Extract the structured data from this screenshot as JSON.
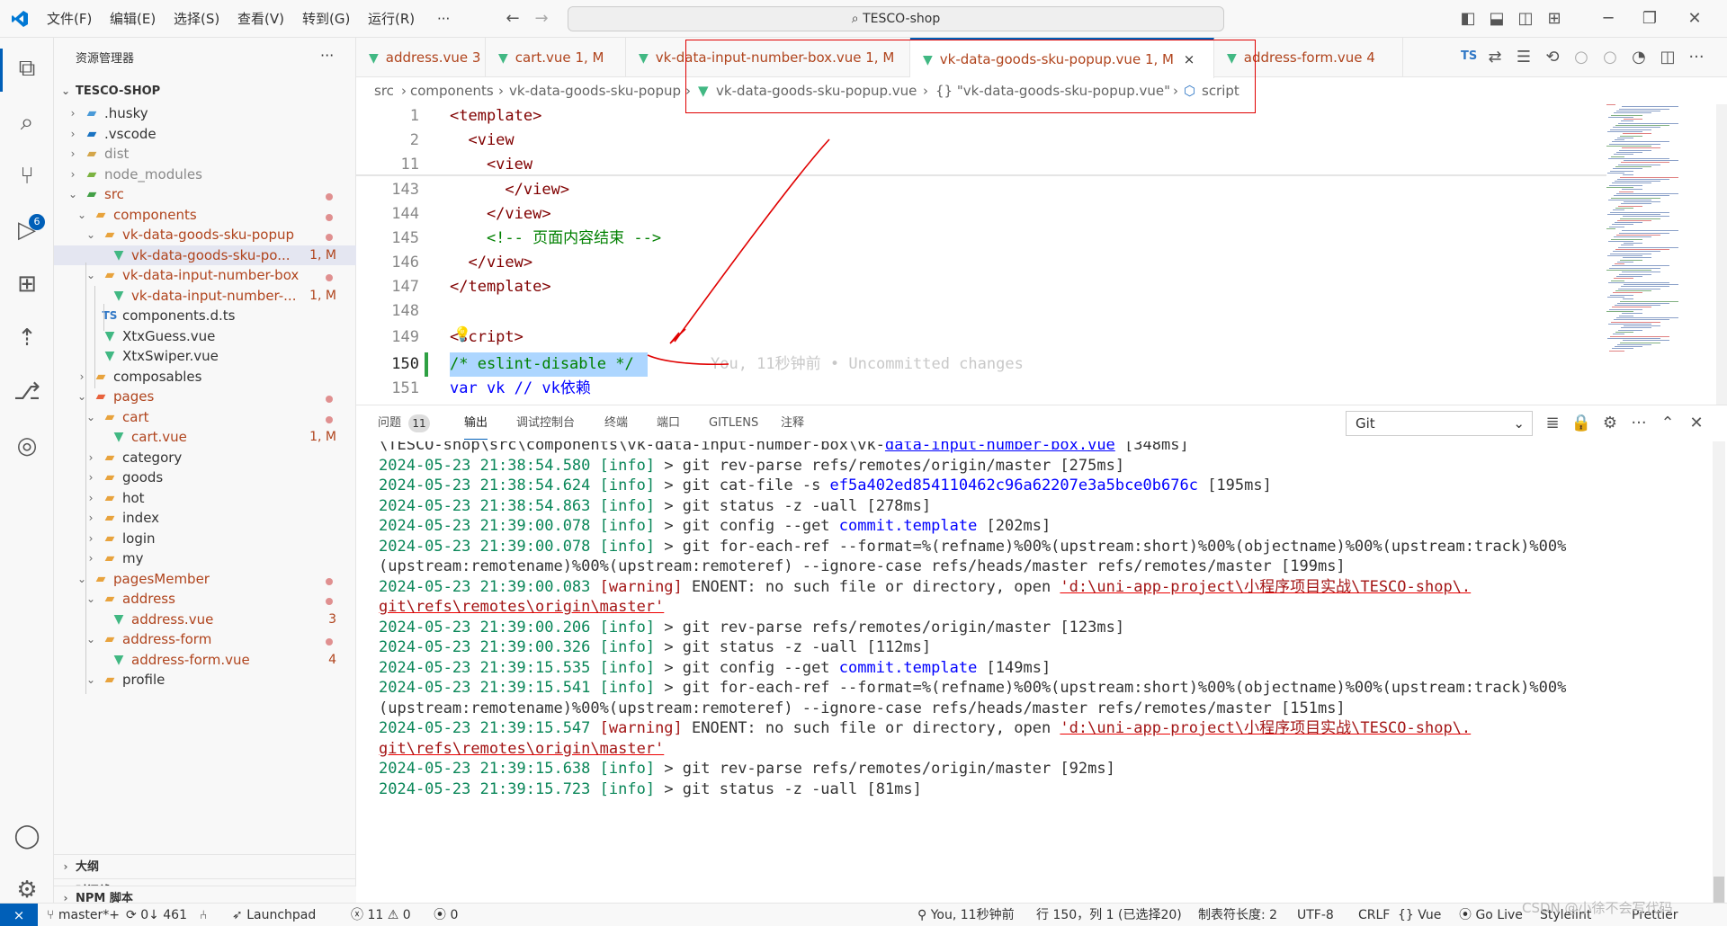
{
  "menu": [
    "文件(F)",
    "编辑(E)",
    "选择(S)",
    "查看(V)",
    "转到(G)",
    "运行(R)",
    "···"
  ],
  "search": {
    "text": "TESCO-shop"
  },
  "activity_badge": "6",
  "sidebar": {
    "title": "资源管理器",
    "more": "···",
    "root": "TESCO-SHOP",
    "items": [
      {
        "label": ".husky"
      },
      {
        "label": ".vscode"
      },
      {
        "label": "dist"
      },
      {
        "label": "node_modules"
      },
      {
        "label": "src"
      },
      {
        "label": "components"
      },
      {
        "label": "vk-data-goods-sku-popup"
      },
      {
        "label": "vk-data-goods-sku-po...",
        "badge": "1, M"
      },
      {
        "label": "vk-data-input-number-box"
      },
      {
        "label": "vk-data-input-number-...",
        "badge": "1, M"
      },
      {
        "label": "components.d.ts",
        "icon": "TS"
      },
      {
        "label": "XtxGuess.vue"
      },
      {
        "label": "XtxSwiper.vue"
      },
      {
        "label": "composables"
      },
      {
        "label": "pages"
      },
      {
        "label": "cart"
      },
      {
        "label": "cart.vue",
        "badge": "1, M"
      },
      {
        "label": "category"
      },
      {
        "label": "goods"
      },
      {
        "label": "hot"
      },
      {
        "label": "index"
      },
      {
        "label": "login"
      },
      {
        "label": "my"
      },
      {
        "label": "pagesMember"
      },
      {
        "label": "address"
      },
      {
        "label": "address.vue",
        "badge": "3"
      },
      {
        "label": "address-form"
      },
      {
        "label": "address-form.vue",
        "badge": "4"
      },
      {
        "label": "profile"
      }
    ],
    "sections": [
      "大纲",
      "时间线",
      "NPM 脚本"
    ]
  },
  "tabs": [
    {
      "label": "address.vue",
      "badge": "3"
    },
    {
      "label": "cart.vue",
      "badge": "1, M"
    },
    {
      "label": "vk-data-input-number-box.vue",
      "badge": "1, M"
    },
    {
      "label": "vk-data-goods-sku-popup.vue",
      "badge": "1, M",
      "close": "×"
    },
    {
      "label": "address-form.vue",
      "badge": "4"
    }
  ],
  "ts_label": "TS",
  "breadcrumb": {
    "p1": "src",
    "p2": "components",
    "p3": "vk-data-goods-sku-popup",
    "p4": "vk-data-goods-sku-popup.vue",
    "p5": "{} \"vk-data-goods-sku-popup.vue\"",
    "p6": "script"
  },
  "code": [
    {
      "n": "1",
      "t": "<template>"
    },
    {
      "n": "2",
      "t": "  <view"
    },
    {
      "n": "11",
      "t": "    <view"
    },
    {
      "n": "143",
      "t": "      </view>"
    },
    {
      "n": "144",
      "t": "    </view>"
    },
    {
      "n": "145",
      "t": "    <!-- 页面内容结束 -->"
    },
    {
      "n": "146",
      "t": "  </view>"
    },
    {
      "n": "147",
      "t": "</template>"
    },
    {
      "n": "148",
      "t": ""
    },
    {
      "n": "149",
      "t": "<script>"
    },
    {
      "n": "150",
      "t": "/* eslint-disable */"
    },
    {
      "n": "151",
      "t": "var vk // vk依赖"
    }
  ],
  "blame": "You, 11秒钟前 • Uncommitted changes",
  "panel": {
    "tabs": [
      "问题",
      "输出",
      "调试控制台",
      "终端",
      "端口",
      "GITLENS",
      "注释"
    ],
    "problems_count": "11",
    "channel": "Git"
  },
  "log": [
    {
      "pre": "\\TESCO-shop\\src\\components\\vk-data-input-number-box\\vk-",
      "link": "data-input-number-box.vue",
      "post": " [348ms]"
    },
    {
      "ts": "2024-05-23 21:38:54.580",
      "lvl": "[info]",
      "msg": " > git rev-parse refs/remotes/origin/master [275ms]"
    },
    {
      "ts": "2024-05-23 21:38:54.624",
      "lvl": "[info]",
      "msg": " > git cat-file -s ",
      "hash": "ef5a402ed854110462c96a62207e3a5bce0b676c",
      "post": " [195ms]"
    },
    {
      "ts": "2024-05-23 21:38:54.863",
      "lvl": "[info]",
      "msg": " > git status -z -uall [278ms]"
    },
    {
      "ts": "2024-05-23 21:39:00.078",
      "lvl": "[info]",
      "msg": " > git config --get ",
      "hash": "commit.template",
      "post": " [202ms]"
    },
    {
      "ts": "2024-05-23 21:39:00.078",
      "lvl": "[info]",
      "msg": " > git for-each-ref --format=%(refname)%00%(upstream:short)%00%(objectname)%00%(upstream:track)%00%"
    },
    {
      "pre": "(upstream:remotename)%00%(upstream:remoteref) --ignore-case refs/heads/master refs/remotes/master [199ms]"
    },
    {
      "ts": "2024-05-23 21:39:00.083",
      "lvl": "[warning]",
      "msg": " ENOENT: no such file or directory, open ",
      "path": "'d:\\uni-app-project\\小程序项目实战\\TESCO-shop\\."
    },
    {
      "path2": "git\\refs\\remotes\\origin\\master'"
    },
    {
      "ts": "2024-05-23 21:39:00.206",
      "lvl": "[info]",
      "msg": " > git rev-parse refs/remotes/origin/master [123ms]"
    },
    {
      "ts": "2024-05-23 21:39:00.326",
      "lvl": "[info]",
      "msg": " > git status -z -uall [112ms]"
    },
    {
      "ts": "2024-05-23 21:39:15.535",
      "lvl": "[info]",
      "msg": " > git config --get ",
      "hash": "commit.template",
      "post": " [149ms]"
    },
    {
      "ts": "2024-05-23 21:39:15.541",
      "lvl": "[info]",
      "msg": " > git for-each-ref --format=%(refname)%00%(upstream:short)%00%(objectname)%00%(upstream:track)%00%"
    },
    {
      "pre": "(upstream:remotename)%00%(upstream:remoteref) --ignore-case refs/heads/master refs/remotes/master [151ms]"
    },
    {
      "ts": "2024-05-23 21:39:15.547",
      "lvl": "[warning]",
      "msg": " ENOENT: no such file or directory, open ",
      "path": "'d:\\uni-app-project\\小程序项目实战\\TESCO-shop\\."
    },
    {
      "path2": "git\\refs\\remotes\\origin\\master'"
    },
    {
      "ts": "2024-05-23 21:39:15.638",
      "lvl": "[info]",
      "msg": " > git rev-parse refs/remotes/origin/master [92ms]"
    },
    {
      "ts": "2024-05-23 21:39:15.723",
      "lvl": "[info]",
      "msg": " > git status -z -uall [81ms]"
    }
  ],
  "status": {
    "branch": "master*+",
    "sync": "0↓ 461",
    "launchpad": "Launchpad",
    "errors": "11",
    "warnings": "0",
    "ports": "0",
    "blame": "You, 11秒钟前",
    "position": "行 150，列 1 (已选择20)",
    "tab": "制表符长度: 2",
    "encoding": "UTF-8",
    "eol": "CRLF",
    "lang": "Vue",
    "golive": "Go Live",
    "stylelint": "Stylelint",
    "prettier": "Prettier",
    "watermark": "CSDN @小徐不会写代码"
  },
  "colors": {
    "accent": "#007acc",
    "annotation": "#e00000",
    "vue": "#41b883"
  }
}
